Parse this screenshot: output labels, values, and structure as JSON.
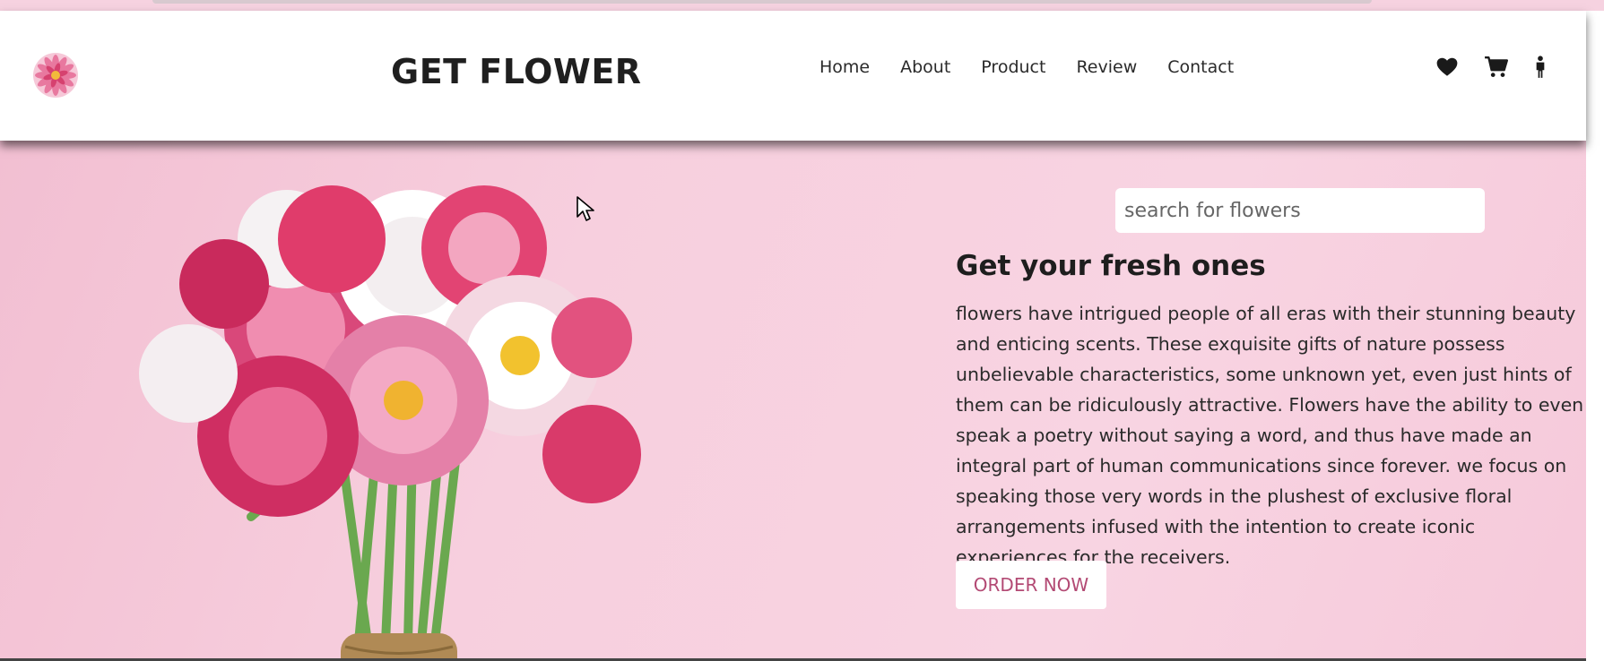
{
  "brand": "GET FLOWER",
  "nav": [
    "Home",
    "About",
    "Product",
    "Review",
    "Contact"
  ],
  "header_icons": [
    "heart-icon",
    "cart-icon",
    "user-icon"
  ],
  "search": {
    "placeholder": "search for flowers"
  },
  "hero": {
    "headline": "Get your fresh ones",
    "description": "flowers have intrigued people of all eras with their stunning beauty and enticing scents. These exquisite gifts of nature possess unbelievable characteristics, some unknown yet, even just hints of them can be ridiculously attractive. Flowers have the ability to even speak a poetry without saying a word, and thus have made an integral part of human communications since forever. we focus on speaking those very words in the plushest of exclusive floral arrangements infused with the intention to create iconic experiences for the receivers.",
    "cta": "ORDER NOW"
  },
  "colors": {
    "hero_bg": "#f7cfde",
    "cta_text": "#b34a74",
    "brand_text": "#1f1f1f"
  }
}
